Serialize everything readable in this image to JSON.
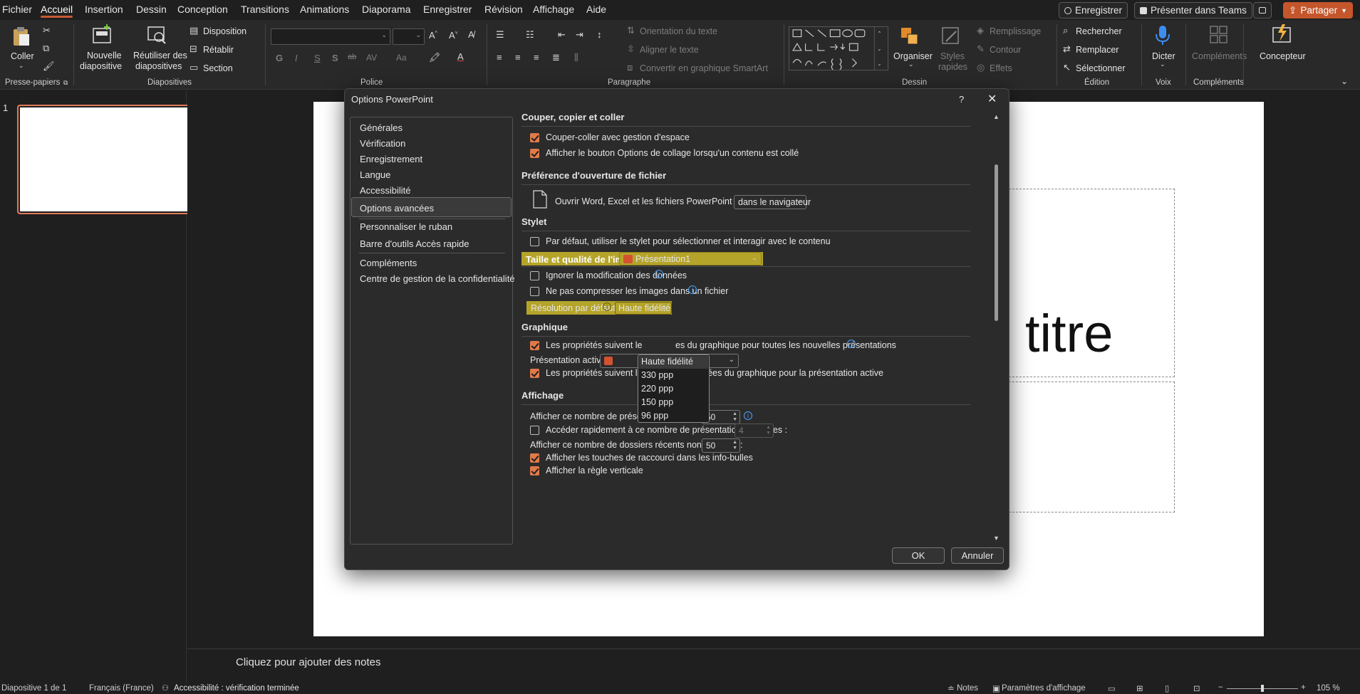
{
  "menubar": {
    "items": [
      "Fichier",
      "Accueil",
      "Insertion",
      "Dessin",
      "Conception",
      "Transitions",
      "Animations",
      "Diaporama",
      "Enregistrer",
      "Révision",
      "Affichage",
      "Aide"
    ],
    "record_label": "Enregistrer",
    "teams_label": "Présenter dans Teams",
    "share_label": "Partager"
  },
  "ribbon": {
    "clipboard": {
      "paste": "Coller",
      "label": "Presse-papiers"
    },
    "slides": {
      "new_line1": "Nouvelle",
      "new_line2": "diapositive",
      "reuse_line1": "Réutiliser des",
      "reuse_line2": "diapositives",
      "layout": "Disposition",
      "reset": "Rétablir",
      "section": "Section",
      "label": "Diapositives"
    },
    "font": {
      "label": "Police",
      "bold": "G",
      "italic": "I",
      "underline": "S",
      "shadow": "S",
      "strike": "ab",
      "spacing": "AV",
      "case": "Aa"
    },
    "paragraph": {
      "label": "Paragraphe",
      "orientation": "Orientation du texte",
      "align_text": "Aligner le texte",
      "smartart": "Convertir en graphique SmartArt"
    },
    "drawing": {
      "label": "Dessin",
      "arrange": "Organiser",
      "styles_line1": "Styles",
      "styles_line2": "rapides",
      "fill": "Remplissage",
      "outline": "Contour",
      "effects": "Effets"
    },
    "editing": {
      "label": "Édition",
      "find": "Rechercher",
      "replace": "Remplacer",
      "select": "Sélectionner"
    },
    "voice": {
      "label": "Voix",
      "dictate": "Dicter"
    },
    "addins": {
      "label": "Compléments",
      "addins": "Compléments"
    },
    "designer": {
      "label": "Concepteur"
    }
  },
  "thumbnails": {
    "slide_number": "1"
  },
  "slide": {
    "title_visible": "titre"
  },
  "notes": {
    "placeholder": "Cliquez pour ajouter des notes"
  },
  "statusbar": {
    "slide_info": "Diapositive 1 de 1",
    "language": "Français (France)",
    "accessibility": "Accessibilité : vérification terminée",
    "notes": "Notes",
    "display_settings": "Paramètres d'affichage",
    "zoom": "105 %"
  },
  "dialog": {
    "title": "Options PowerPoint",
    "help": "?",
    "nav": [
      "Générales",
      "Vérification",
      "Enregistrement",
      "Langue",
      "Accessibilité",
      "Options avancées",
      "Personnaliser le ruban",
      "Barre d'outils Accès rapide",
      "Compléments",
      "Centre de gestion de la confidentialité"
    ],
    "selected_nav": "Options avancées",
    "sections": {
      "cut_copy": {
        "title": "Couper, copier et coller",
        "opt1": "Couper-coller avec gestion d'espace",
        "opt2": "Afficher le bouton Options de collage lorsqu'un contenu est collé"
      },
      "file_open": {
        "title": "Préférence d'ouverture de fichier",
        "label": "Ouvrir Word, Excel et les fichiers PowerPoint à l'aide de :",
        "value": "dans le navigateur"
      },
      "pen": {
        "title": "Stylet",
        "opt1": "Par défaut, utiliser le stylet pour sélectionner et interagir avec le contenu"
      },
      "image": {
        "title": "Taille et qualité de l'image",
        "presentation": "Présentation1",
        "opt1": "Ignorer la modification des données",
        "opt2": "Ne pas compresser les images dans un fichier",
        "resolution_label": "Résolution par défaut :",
        "resolution_value": "Haute fidélité"
      },
      "chart": {
        "title": "Graphique",
        "opt1_a": "Les propriétés suivent le",
        "opt1_b": "es du graphique pour toutes les nouvelles présentations",
        "active_label": "Présentation active :",
        "opt2": "Les propriétés suivent les points de données du graphique pour la présentation active"
      },
      "display": {
        "title": "Affichage",
        "recent_label": "Afficher ce nombre de présentations récentes :",
        "recent_value": "50",
        "quick_label": "Accéder rapidement à ce nombre de présentations récentes :",
        "quick_value": "4",
        "folders_label": "Afficher ce nombre de dossiers récents non attachés :",
        "folders_value": "50",
        "opt_shortcuts": "Afficher les touches de raccourci dans les info-bulles",
        "opt_ruler": "Afficher la règle verticale"
      }
    },
    "dropdown_options": [
      "Haute fidélité",
      "330 ppp",
      "220 ppp",
      "150 ppp",
      "96 ppp"
    ],
    "ok": "OK",
    "cancel": "Annuler"
  },
  "colors": {
    "accent": "#c55a35",
    "checkbox": "#e07a4a",
    "highlight": "#b5a42a"
  }
}
